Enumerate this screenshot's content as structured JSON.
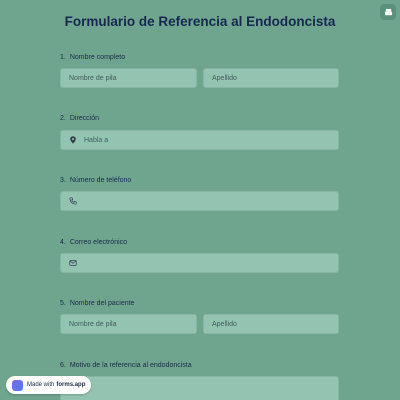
{
  "form": {
    "title": "Formulario de Referencia al Endodoncista"
  },
  "questions": [
    {
      "number": "1.",
      "label": "Nombre completo",
      "first_placeholder": "Nombre de pila",
      "last_placeholder": "Apellido"
    },
    {
      "number": "2.",
      "label": "Dirección",
      "placeholder": "Habla a",
      "icon": "location-pin-icon"
    },
    {
      "number": "3.",
      "label": "Número de teléfono",
      "icon": "phone-icon"
    },
    {
      "number": "4.",
      "label": "Correo electrónico",
      "icon": "mail-icon"
    },
    {
      "number": "5.",
      "label": "Nombre del paciente",
      "first_placeholder": "Nombre de pila",
      "last_placeholder": "Apellido"
    },
    {
      "number": "6.",
      "label": "Motivo de la referencia al endodoncista"
    }
  ],
  "badge": {
    "prefix": "Made with",
    "brand": "forms.app"
  },
  "colors": {
    "background": "#6fa58f",
    "field": "#93c3b1",
    "title": "#16284f"
  }
}
